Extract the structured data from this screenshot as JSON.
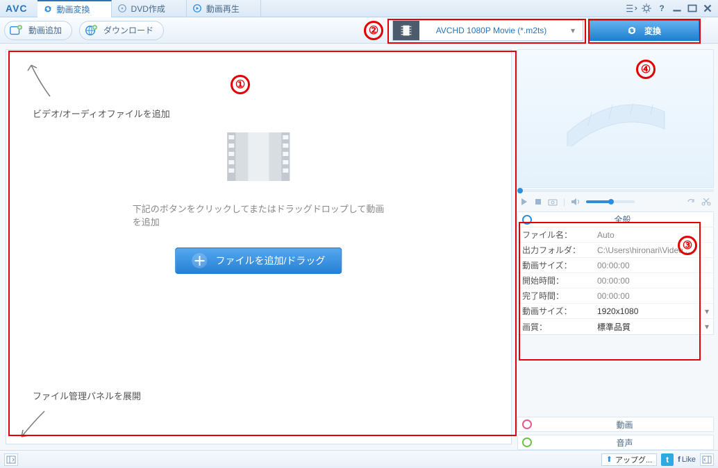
{
  "app": {
    "logo": "AVC"
  },
  "tabs": [
    {
      "label": "動画変換"
    },
    {
      "label": "DVD作成"
    },
    {
      "label": "動画再生"
    }
  ],
  "toolbar": {
    "add_video": "動画追加",
    "download": "ダウンロード",
    "format_label": "AVCHD 1080P Movie (*.m2ts)",
    "convert": "変換"
  },
  "dropzone": {
    "hint_add": "ビデオ/オーディオファイルを追加",
    "hint_expand": "ファイル管理パネルを展開",
    "instruction": "下記のボタンをクリックしてまたはドラッグドロップして動画を追加",
    "add_button": "ファイルを追加/ドラッグ"
  },
  "info": {
    "header": "全般",
    "filename_k": "ファイル名：",
    "filename_v": "Auto",
    "outfolder_k": "出力フォルダ：",
    "outfolder_v": "C:\\Users\\hironari\\Video...",
    "videosize_k": "動画サイズ：",
    "videosize_v": "00:00:00",
    "start_k": "開始時間：",
    "start_v": "00:00:00",
    "end_k": "完了時間：",
    "end_v": "00:00:00",
    "res_k": "動画サイズ：",
    "res_v": "1920x1080",
    "quality_k": "画質：",
    "quality_v": "標準品質"
  },
  "subpanels": {
    "video": "動画",
    "audio": "音声"
  },
  "callouts": {
    "1": "①",
    "2": "②",
    "3": "③",
    "4": "④"
  },
  "statusbar": {
    "upgrade": "アップグ...",
    "like": "Like"
  }
}
